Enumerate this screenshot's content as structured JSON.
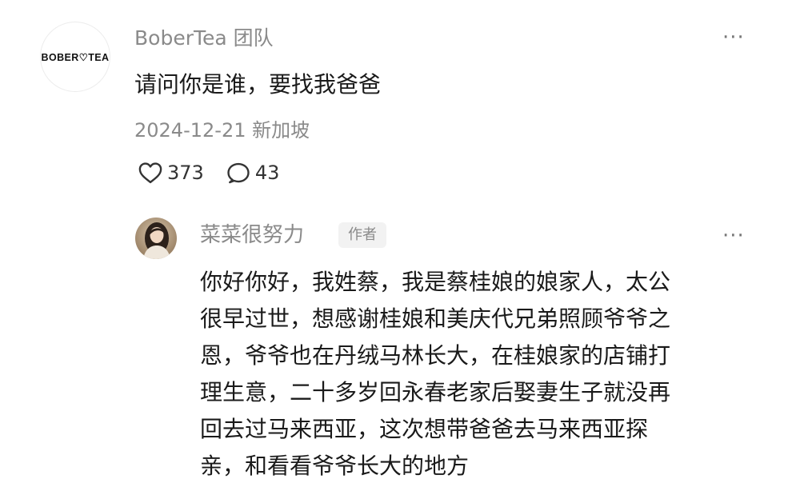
{
  "comment": {
    "author": "BoberTea 团队",
    "avatar_logo_text": "BOBER♡TEA",
    "text": "请问你是谁，要找我爸爸",
    "date": "2024-12-21",
    "location": "新加坡",
    "likes": "373",
    "replies": "43",
    "more_label": "···",
    "icons": {
      "like": "heart-icon",
      "reply": "comment-bubble-icon",
      "more": "ellipsis-icon"
    }
  },
  "reply": {
    "author": "菜菜很努力",
    "badge": "作者",
    "more_label": "···",
    "lines": [
      "你好你好，我姓蔡，我是蔡桂娘的娘家人，太公",
      "很早过世，想感谢桂娘和美庆代兄弟照顾爷爷之",
      "恩，爷爷也在丹绒马林长大，在桂娘家的店铺打",
      "理生意，二十多岁回永春老家后娶妻生子就没再",
      "回去过马来西亚，这次想带爸爸去马来西亚探",
      "亲，和看看爷爷长大的地方"
    ]
  }
}
